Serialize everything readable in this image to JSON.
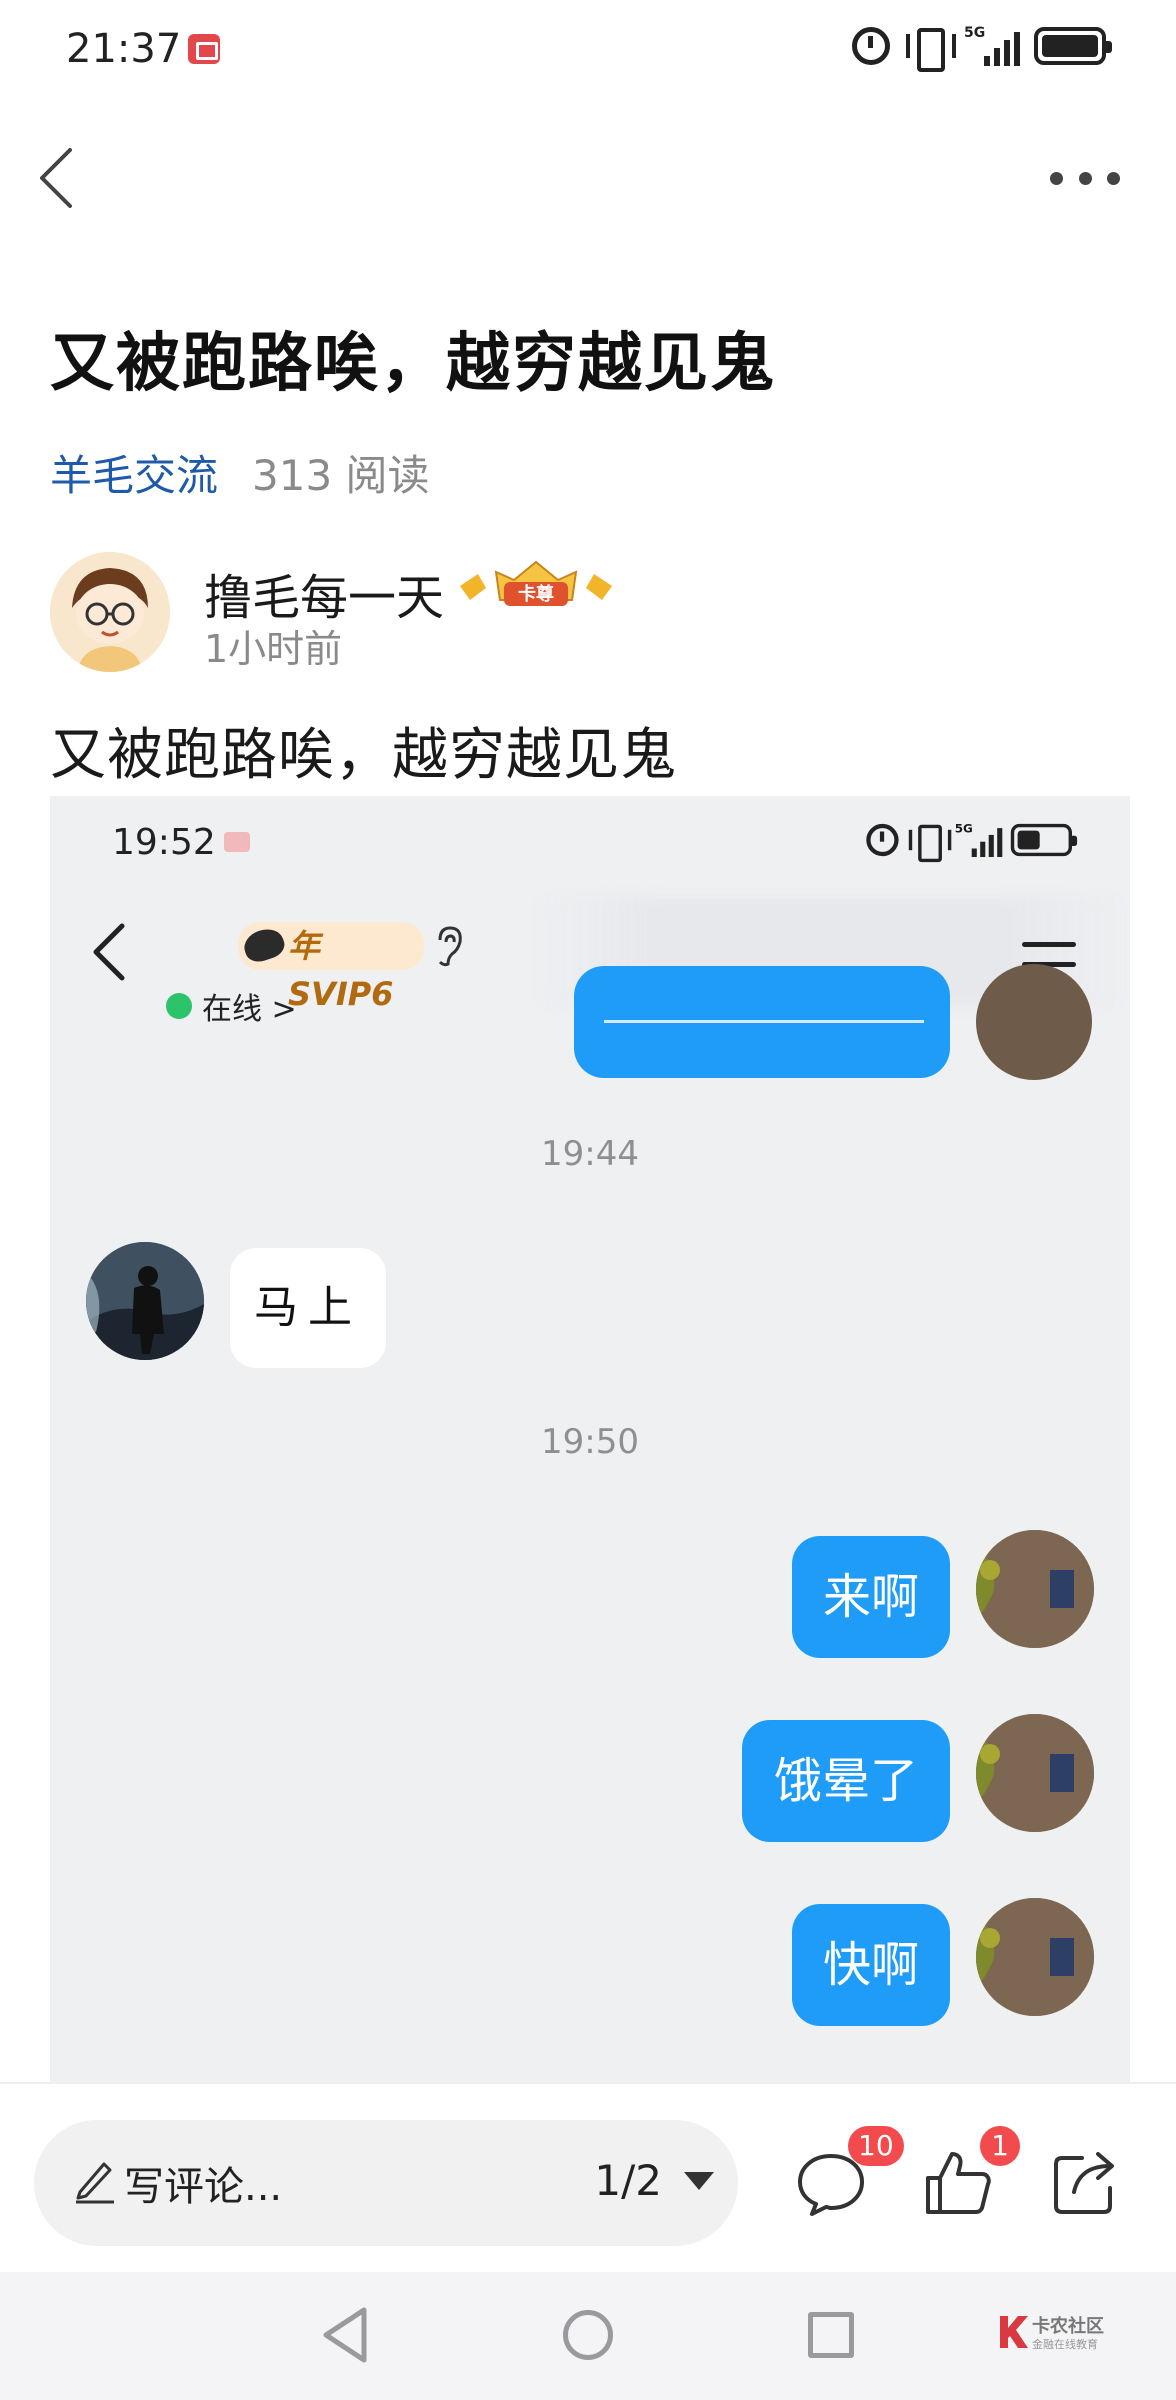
{
  "status_bar": {
    "time": "21:37",
    "network": "5G"
  },
  "post": {
    "title": "又被跑路唉，越穷越见鬼",
    "category": "羊毛交流",
    "reads": "313 阅读",
    "author": {
      "name": "撸毛每一天",
      "time": "1小时前",
      "badge": "卡尊"
    },
    "body": "又被跑路唉，越穷越见鬼"
  },
  "embedded_screenshot": {
    "status_time": "19:52",
    "network": "5G",
    "vip_tag": "年SVIP6",
    "online_status": "在线 >",
    "messages": [
      {
        "type": "timestamp",
        "text": "19:44"
      },
      {
        "type": "received",
        "text": "马上"
      },
      {
        "type": "timestamp",
        "text": "19:50"
      },
      {
        "type": "sent",
        "text": "来啊"
      },
      {
        "type": "sent",
        "text": "饿晕了"
      },
      {
        "type": "sent",
        "text": "快啊"
      }
    ]
  },
  "bottom_bar": {
    "comment_placeholder": "写评论...",
    "page_indicator": "1/2",
    "comment_count": "10",
    "like_count": "1"
  },
  "watermark": {
    "name": "卡农社区",
    "sub": "金融在线教育"
  },
  "colors": {
    "accent_blue": "#1e9cf7",
    "category_blue": "#1e5aa8",
    "badge_red": "#f24a4d",
    "online_green": "#2cc36b"
  }
}
